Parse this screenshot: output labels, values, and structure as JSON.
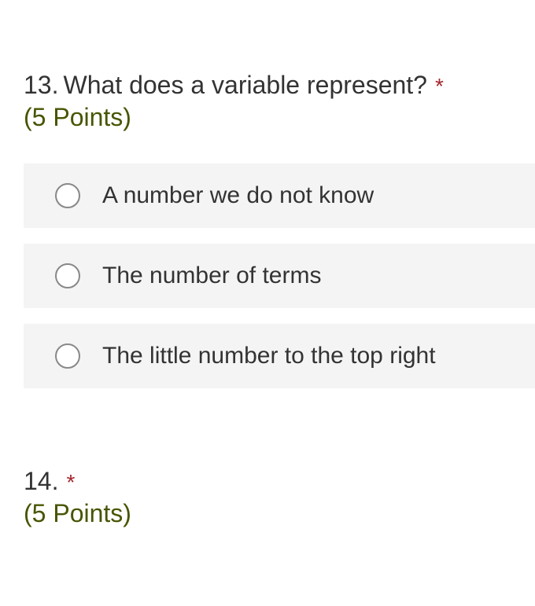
{
  "questions": [
    {
      "number": "13.",
      "text": "What does a variable represent?",
      "required": "*",
      "points": "(5 Points)",
      "options": [
        {
          "label": "A number we do not know"
        },
        {
          "label": "The number of terms"
        },
        {
          "label": "The little number to the top right"
        }
      ]
    },
    {
      "number": "14.",
      "text": "",
      "required": "*",
      "points": "(5 Points)"
    }
  ]
}
